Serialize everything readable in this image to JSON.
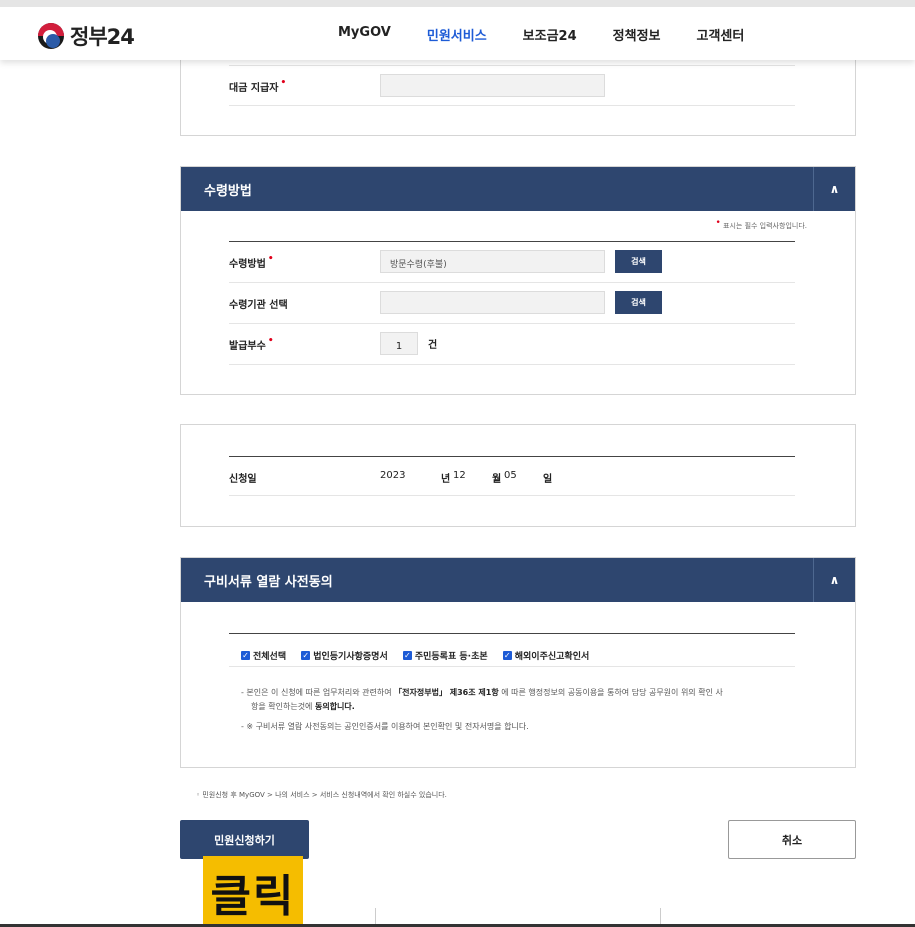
{
  "header": {
    "logo_text": "정부24",
    "nav": [
      "MyGOV",
      "민원서비스",
      "보조금24",
      "정책정보",
      "고객센터"
    ],
    "active_nav": "민원서비스"
  },
  "section_payee": {
    "label": "대금 지급자",
    "value": ""
  },
  "section_receive": {
    "title": "수령방법",
    "required_note": "표시는 필수 입력사항입니다.",
    "method_label": "수령방법",
    "method_value": "방문수령(후불)",
    "method_btn": "검색",
    "office_label": "수령기관 선택",
    "office_value": "",
    "office_btn": "검색",
    "copies_label": "발급부수",
    "copies_value": "1",
    "copies_unit": "건"
  },
  "section_date": {
    "label": "신청일",
    "year": "2023",
    "year_unit": "년",
    "month": "12",
    "month_unit": "월",
    "day": "05",
    "day_unit": "일"
  },
  "section_consent": {
    "title": "구비서류 열람 사전동의",
    "checkboxes": [
      "전체선택",
      "법인등기사항증명서",
      "주민등록표 등·초본",
      "해외이주신고확인서"
    ],
    "desc1_a": "- 본인은 이 신청에 따른 업무처리와 관련하여 ",
    "desc1_b": "「전자정부법」 제36조 제1항",
    "desc1_c": " 에 따른 행정정보의 공동이용을 통하여 담당 공무원이 위의 확인 사",
    "desc1_d": "항을 확인하는것에 ",
    "desc1_e": "동의합니다.",
    "desc2": "- ※ 구비서류 열람 사전동의는 공인인증서를 이용하여 본인확인 및 전자서명을 합니다."
  },
  "footnote": "민원신청 후 MyGOV > 나의 서비스 > 서비스 신청내역에서 확인 하실수 있습니다.",
  "buttons": {
    "submit": "민원신청하기",
    "cancel": "취소"
  },
  "overlay_label": "클릭",
  "colors": {
    "header_blue": "#2e466f",
    "active_nav": "#1d5bd6",
    "overlay_yellow": "#f5bd00"
  }
}
